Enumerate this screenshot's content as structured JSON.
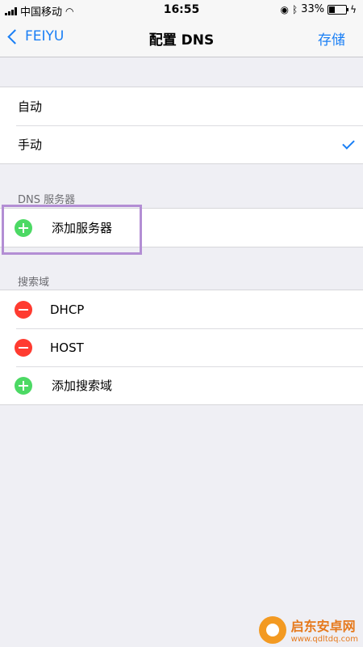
{
  "status_bar": {
    "carrier": "中国移动",
    "time": "16:55",
    "battery": "33%",
    "battery_level": 0.33
  },
  "nav": {
    "back_label": "FEIYU",
    "title": "配置 DNS",
    "save_label": "存储"
  },
  "mode_group": {
    "items": [
      {
        "label": "自动",
        "selected": false
      },
      {
        "label": "手动",
        "selected": true
      }
    ]
  },
  "dns_section": {
    "header": "DNS 服务器",
    "add_label": "添加服务器"
  },
  "search_section": {
    "header": "搜索域",
    "domains": [
      {
        "label": "DHCP"
      },
      {
        "label": "HOST"
      }
    ],
    "add_label": "添加搜索域"
  },
  "watermark": {
    "name": "启东安卓网",
    "url": "www.qdltdq.com"
  },
  "colors": {
    "accent": "#1a7ff5",
    "add": "#4cd964",
    "remove": "#ff3b30",
    "highlight": "#b38ed4"
  }
}
